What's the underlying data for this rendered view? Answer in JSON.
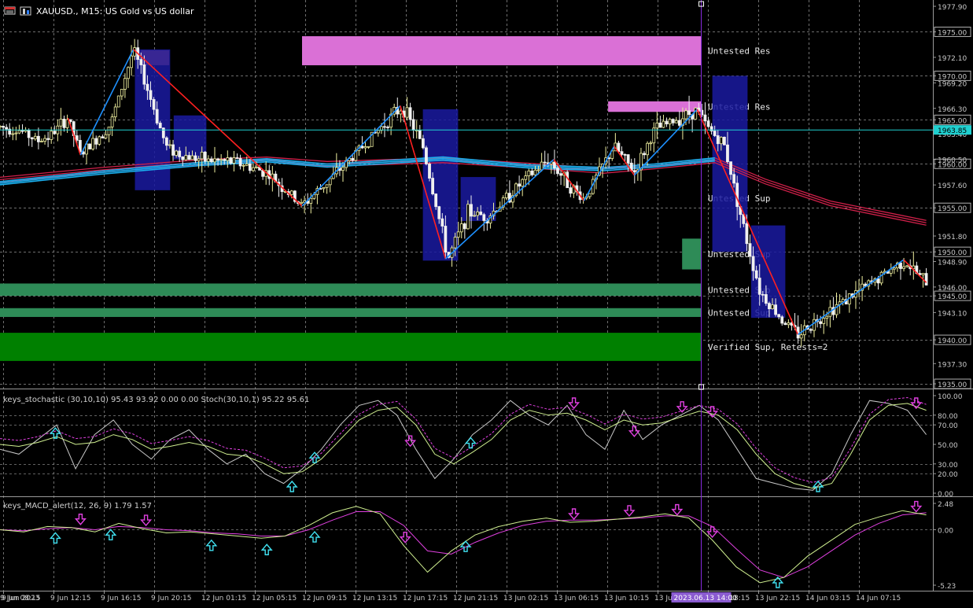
{
  "window": {
    "symbol_title": "XAUUSD., M15:  US Gold vs US dollar",
    "colors": {
      "background": "#000000",
      "grid": "#8a8a8a",
      "axis_text": "#c8c8c8",
      "bull": "#f0f0a0",
      "bear": "#f0f0f0",
      "price_line": "#20d0d0",
      "zigzag_up": "#1e90ff",
      "zigzag_down": "#ff2020",
      "ma_red": "#d0204a",
      "ma_blue": "#1ab0f0",
      "resistance_zone": "#da70d6",
      "support_zone": "#2e8b57",
      "verified_support_zone": "#008000",
      "session_box": "#1a1aa0",
      "cursor_line": "#8a2be2",
      "stoch_main": "#c8c8c8",
      "stoch_signal": "#d0f090",
      "signal_magenta": "#e040e0",
      "arrow_up": "#40e0f0",
      "arrow_down": "#e040e0"
    }
  },
  "price_axis": {
    "labels": [
      "1977.90",
      "1975.00",
      "1972.10",
      "1970.00",
      "1969.20",
      "1966.30",
      "1965.00",
      "1963.40",
      "1960.50",
      "1960.00",
      "1957.60",
      "1955.00",
      "1951.80",
      "1950.00",
      "1948.90",
      "1946.00",
      "1945.00",
      "1943.10",
      "1940.00",
      "1937.30",
      "1935.00"
    ],
    "boxed_labels": [
      "1975.00",
      "1970.00",
      "1965.00",
      "1960.00",
      "1955.00",
      "1950.00",
      "1945.00",
      "1940.00",
      "1935.00"
    ],
    "current_price": "1963.85"
  },
  "zones": [
    {
      "type": "resistance",
      "label": "Untested Res",
      "top": 1974.5,
      "bottom": 1971.2,
      "start": 6,
      "end": 18
    },
    {
      "type": "resistance",
      "label": "Untested Res",
      "top": 1967.1,
      "bottom": 1965.9,
      "start": 12.08,
      "end": 18
    },
    {
      "type": "support",
      "label": "Untested Sup",
      "top": 1956.8,
      "bottom": 1955.4,
      "start": 14.25,
      "end": 18
    },
    {
      "type": "support",
      "label": "Untested Sup",
      "top": 1951.5,
      "bottom": 1948.0,
      "start": 13.55,
      "end": 18
    },
    {
      "type": "support",
      "label": "Untested Sup",
      "top": 1946.4,
      "bottom": 1945.0,
      "start": 0,
      "end": 18
    },
    {
      "type": "support",
      "label": "Untested Sup",
      "top": 1943.6,
      "bottom": 1942.6,
      "start": 0,
      "end": 18
    },
    {
      "type": "verified_support",
      "label": "Verified Sup, Retests=2",
      "top": 1940.8,
      "bottom": 1937.6,
      "start": 0,
      "end": 18
    }
  ],
  "stoch_panel": {
    "title": "keys_stochastic (30,10,10) 95.43 93.92 0.00 0.00 Stoch(30,10,1) 95.22 95.61",
    "axis_labels": [
      "100.00",
      "80.00",
      "70.00",
      "50.00",
      "30.00",
      "20.00",
      "0.00"
    ]
  },
  "macd_panel": {
    "title": "keys_MACD_alert(12, 26, 9) 1.79 1.57",
    "axis_labels": [
      "2.48",
      "0.00",
      "-5.23"
    ]
  },
  "time_axis": {
    "labels": [
      "9 Jun 2023",
      "9 Jun 08:15",
      "9 Jun 12:15",
      "9 Jun 16:15",
      "9 Jun 20:15",
      "12 Jun 01:15",
      "12 Jun 05:15",
      "12 Jun 09:15",
      "12 Jun 13:15",
      "12 Jun 17:15",
      "12 Jun 21:15",
      "13 Jun 02:15",
      "13 Jun 06:15",
      "13 Jun 10:15",
      "13 Jun 14:15",
      "13 Jun 18:15",
      "13 Jun 22:15",
      "14 Jun 03:15",
      "14 Jun 07:15"
    ],
    "cursor_time": "2023.06.13 14:00"
  },
  "chart_data": {
    "type": "candlestick",
    "symbol": "XAUUSD.",
    "timeframe": "M15",
    "y_range": [
      1935.0,
      1977.9
    ],
    "x_categories": [
      "9 Jun 2023",
      "9 Jun 08:15",
      "9 Jun 12:15",
      "9 Jun 16:15",
      "9 Jun 20:15",
      "12 Jun 01:15",
      "12 Jun 05:15",
      "12 Jun 09:15",
      "12 Jun 13:15",
      "12 Jun 17:15",
      "12 Jun 21:15",
      "13 Jun 02:15",
      "13 Jun 06:15",
      "13 Jun 10:15",
      "13 Jun 14:15",
      "13 Jun 18:15",
      "13 Jun 22:15",
      "14 Jun 03:15",
      "14 Jun 07:15"
    ],
    "price_path": [
      [
        0,
        1964.2
      ],
      [
        0.4,
        1963.8
      ],
      [
        0.75,
        1962.6
      ],
      [
        1.0,
        1963.2
      ],
      [
        1.35,
        1965.2
      ],
      [
        1.6,
        1961.0
      ],
      [
        2.2,
        1964.5
      ],
      [
        2.65,
        1973.0
      ],
      [
        2.9,
        1969.0
      ],
      [
        3.3,
        1962.0
      ],
      [
        3.6,
        1961.0
      ],
      [
        4.1,
        1960.4
      ],
      [
        4.7,
        1960.2
      ],
      [
        5.3,
        1959.0
      ],
      [
        6.0,
        1955.2
      ],
      [
        6.6,
        1958.5
      ],
      [
        7.2,
        1962.0
      ],
      [
        7.8,
        1965.5
      ],
      [
        8.0,
        1966.5
      ],
      [
        8.4,
        1962.0
      ],
      [
        8.9,
        1949.2
      ],
      [
        9.3,
        1954.5
      ],
      [
        9.7,
        1954.0
      ],
      [
        10.3,
        1957.5
      ],
      [
        10.9,
        1960.5
      ],
      [
        11.4,
        1957.0
      ],
      [
        11.6,
        1956.0
      ],
      [
        12.2,
        1962.0
      ],
      [
        12.6,
        1959.0
      ],
      [
        13.0,
        1963.8
      ],
      [
        13.85,
        1966.2
      ],
      [
        14.0,
        1964.5
      ],
      [
        14.4,
        1962.0
      ],
      [
        14.8,
        1952.0
      ],
      [
        15.1,
        1945.5
      ],
      [
        15.5,
        1942.5
      ],
      [
        15.85,
        1940.6
      ],
      [
        16.5,
        1943.5
      ],
      [
        17.2,
        1946.0
      ],
      [
        17.95,
        1949.0
      ],
      [
        18.4,
        1946.5
      ]
    ],
    "zigzag": [
      {
        "x": 1.35,
        "y": 1965.2
      },
      {
        "x": 1.6,
        "y": 1961.0
      },
      {
        "x": 2.65,
        "y": 1973.0
      },
      {
        "x": 6.0,
        "y": 1955.2
      },
      {
        "x": 7.95,
        "y": 1966.6
      },
      {
        "x": 8.85,
        "y": 1949.2
      },
      {
        "x": 11.0,
        "y": 1960.5
      },
      {
        "x": 11.6,
        "y": 1955.8
      },
      {
        "x": 12.2,
        "y": 1962.0
      },
      {
        "x": 12.6,
        "y": 1958.7
      },
      {
        "x": 13.85,
        "y": 1966.2
      },
      {
        "x": 15.85,
        "y": 1940.6
      },
      {
        "x": 17.95,
        "y": 1949.1
      },
      {
        "x": 18.4,
        "y": 1946.5
      }
    ],
    "ma_red": [
      [
        0,
        1958.2
      ],
      [
        2,
        1959.3
      ],
      [
        4,
        1960.2
      ],
      [
        5.3,
        1960.5
      ],
      [
        6.5,
        1960.0
      ],
      [
        8.8,
        1960.4
      ],
      [
        10.5,
        1959.8
      ],
      [
        12,
        1959.2
      ],
      [
        13,
        1959.7
      ],
      [
        14.2,
        1960.4
      ],
      [
        15.2,
        1958.0
      ],
      [
        16.5,
        1955.5
      ],
      [
        18.4,
        1953.3
      ]
    ],
    "ma_blue": [
      [
        0,
        1957.8
      ],
      [
        2,
        1959.0
      ],
      [
        4,
        1960.0
      ],
      [
        5.3,
        1960.4
      ],
      [
        6.5,
        1959.8
      ],
      [
        8.8,
        1960.6
      ],
      [
        10.5,
        1959.7
      ],
      [
        12,
        1959.4
      ],
      [
        13,
        1959.8
      ],
      [
        14.2,
        1960.5
      ]
    ],
    "session_boxes": [
      {
        "x0": 2.68,
        "x1": 3.38,
        "top": 1973.0,
        "bottom": 1957.0
      },
      {
        "x0": 3.45,
        "x1": 4.1,
        "top": 1965.5,
        "bottom": 1960.5
      },
      {
        "x0": 8.4,
        "x1": 9.1,
        "top": 1966.2,
        "bottom": 1949.0
      },
      {
        "x0": 9.15,
        "x1": 9.85,
        "top": 1958.5,
        "bottom": 1953.5
      },
      {
        "x0": 14.15,
        "x1": 14.85,
        "top": 1970.0,
        "bottom": 1950.0
      },
      {
        "x0": 14.92,
        "x1": 15.6,
        "top": 1953.0,
        "bottom": 1942.5
      }
    ],
    "cursor_index": 13.93,
    "stoch_main": [
      45,
      40,
      55,
      70,
      25,
      60,
      75,
      50,
      35,
      55,
      65,
      45,
      30,
      40,
      20,
      10,
      25,
      45,
      70,
      90,
      95,
      80,
      45,
      15,
      35,
      60,
      75,
      95,
      80,
      70,
      90,
      60,
      45,
      85,
      55,
      70,
      80,
      90,
      75,
      45,
      15,
      10,
      5,
      3,
      20,
      60,
      95,
      92,
      85,
      60
    ],
    "stoch_signal": [
      50,
      48,
      52,
      58,
      50,
      52,
      60,
      55,
      45,
      48,
      52,
      48,
      40,
      38,
      30,
      20,
      22,
      35,
      55,
      75,
      85,
      88,
      70,
      40,
      30,
      42,
      55,
      75,
      85,
      80,
      82,
      75,
      65,
      75,
      70,
      72,
      78,
      84,
      80,
      65,
      40,
      20,
      10,
      5,
      10,
      40,
      75,
      90,
      92,
      85
    ],
    "stoch_arrows": [
      {
        "x": 1.1,
        "dir": "up"
      },
      {
        "x": 5.8,
        "dir": "up"
      },
      {
        "x": 6.25,
        "dir": "up"
      },
      {
        "x": 8.15,
        "dir": "down"
      },
      {
        "x": 9.35,
        "dir": "up"
      },
      {
        "x": 11.4,
        "dir": "down"
      },
      {
        "x": 12.6,
        "dir": "down"
      },
      {
        "x": 13.55,
        "dir": "down"
      },
      {
        "x": 14.15,
        "dir": "down"
      },
      {
        "x": 16.25,
        "dir": "up"
      },
      {
        "x": 18.2,
        "dir": "down"
      }
    ],
    "macd_main": [
      0,
      -0.2,
      0.3,
      0.2,
      -0.2,
      0.6,
      0.1,
      -0.3,
      -0.2,
      -0.4,
      -0.6,
      -0.8,
      -0.6,
      0.4,
      1.6,
      2.2,
      1.5,
      -1.5,
      -4.0,
      -2.0,
      -0.5,
      0.3,
      0.8,
      1.1,
      0.7,
      0.8,
      1.0,
      1.2,
      1.5,
      1.1,
      -1.0,
      -3.5,
      -5.0,
      -4.5,
      -2.5,
      -1.0,
      0.5,
      1.2,
      1.8,
      1.4
    ],
    "macd_signal": [
      0,
      -0.1,
      0.1,
      0.2,
      0.0,
      0.3,
      0.2,
      0.0,
      -0.1,
      -0.3,
      -0.4,
      -0.6,
      -0.6,
      0.0,
      0.9,
      1.7,
      1.7,
      0.4,
      -2.0,
      -2.3,
      -1.2,
      -0.3,
      0.4,
      0.8,
      0.9,
      0.9,
      1.0,
      1.1,
      1.3,
      1.3,
      0.3,
      -1.8,
      -3.8,
      -4.5,
      -3.5,
      -2.0,
      -0.5,
      0.6,
      1.4,
      1.6
    ],
    "macd_arrows": [
      {
        "x": 1.1,
        "dir": "up"
      },
      {
        "x": 1.6,
        "dir": "down"
      },
      {
        "x": 2.2,
        "dir": "up"
      },
      {
        "x": 2.9,
        "dir": "down"
      },
      {
        "x": 4.2,
        "dir": "up"
      },
      {
        "x": 5.3,
        "dir": "up"
      },
      {
        "x": 6.25,
        "dir": "up"
      },
      {
        "x": 8.05,
        "dir": "down"
      },
      {
        "x": 9.25,
        "dir": "up"
      },
      {
        "x": 11.4,
        "dir": "down"
      },
      {
        "x": 12.5,
        "dir": "down"
      },
      {
        "x": 13.45,
        "dir": "down"
      },
      {
        "x": 14.15,
        "dir": "down"
      },
      {
        "x": 15.45,
        "dir": "up"
      },
      {
        "x": 18.2,
        "dir": "down"
      }
    ]
  }
}
